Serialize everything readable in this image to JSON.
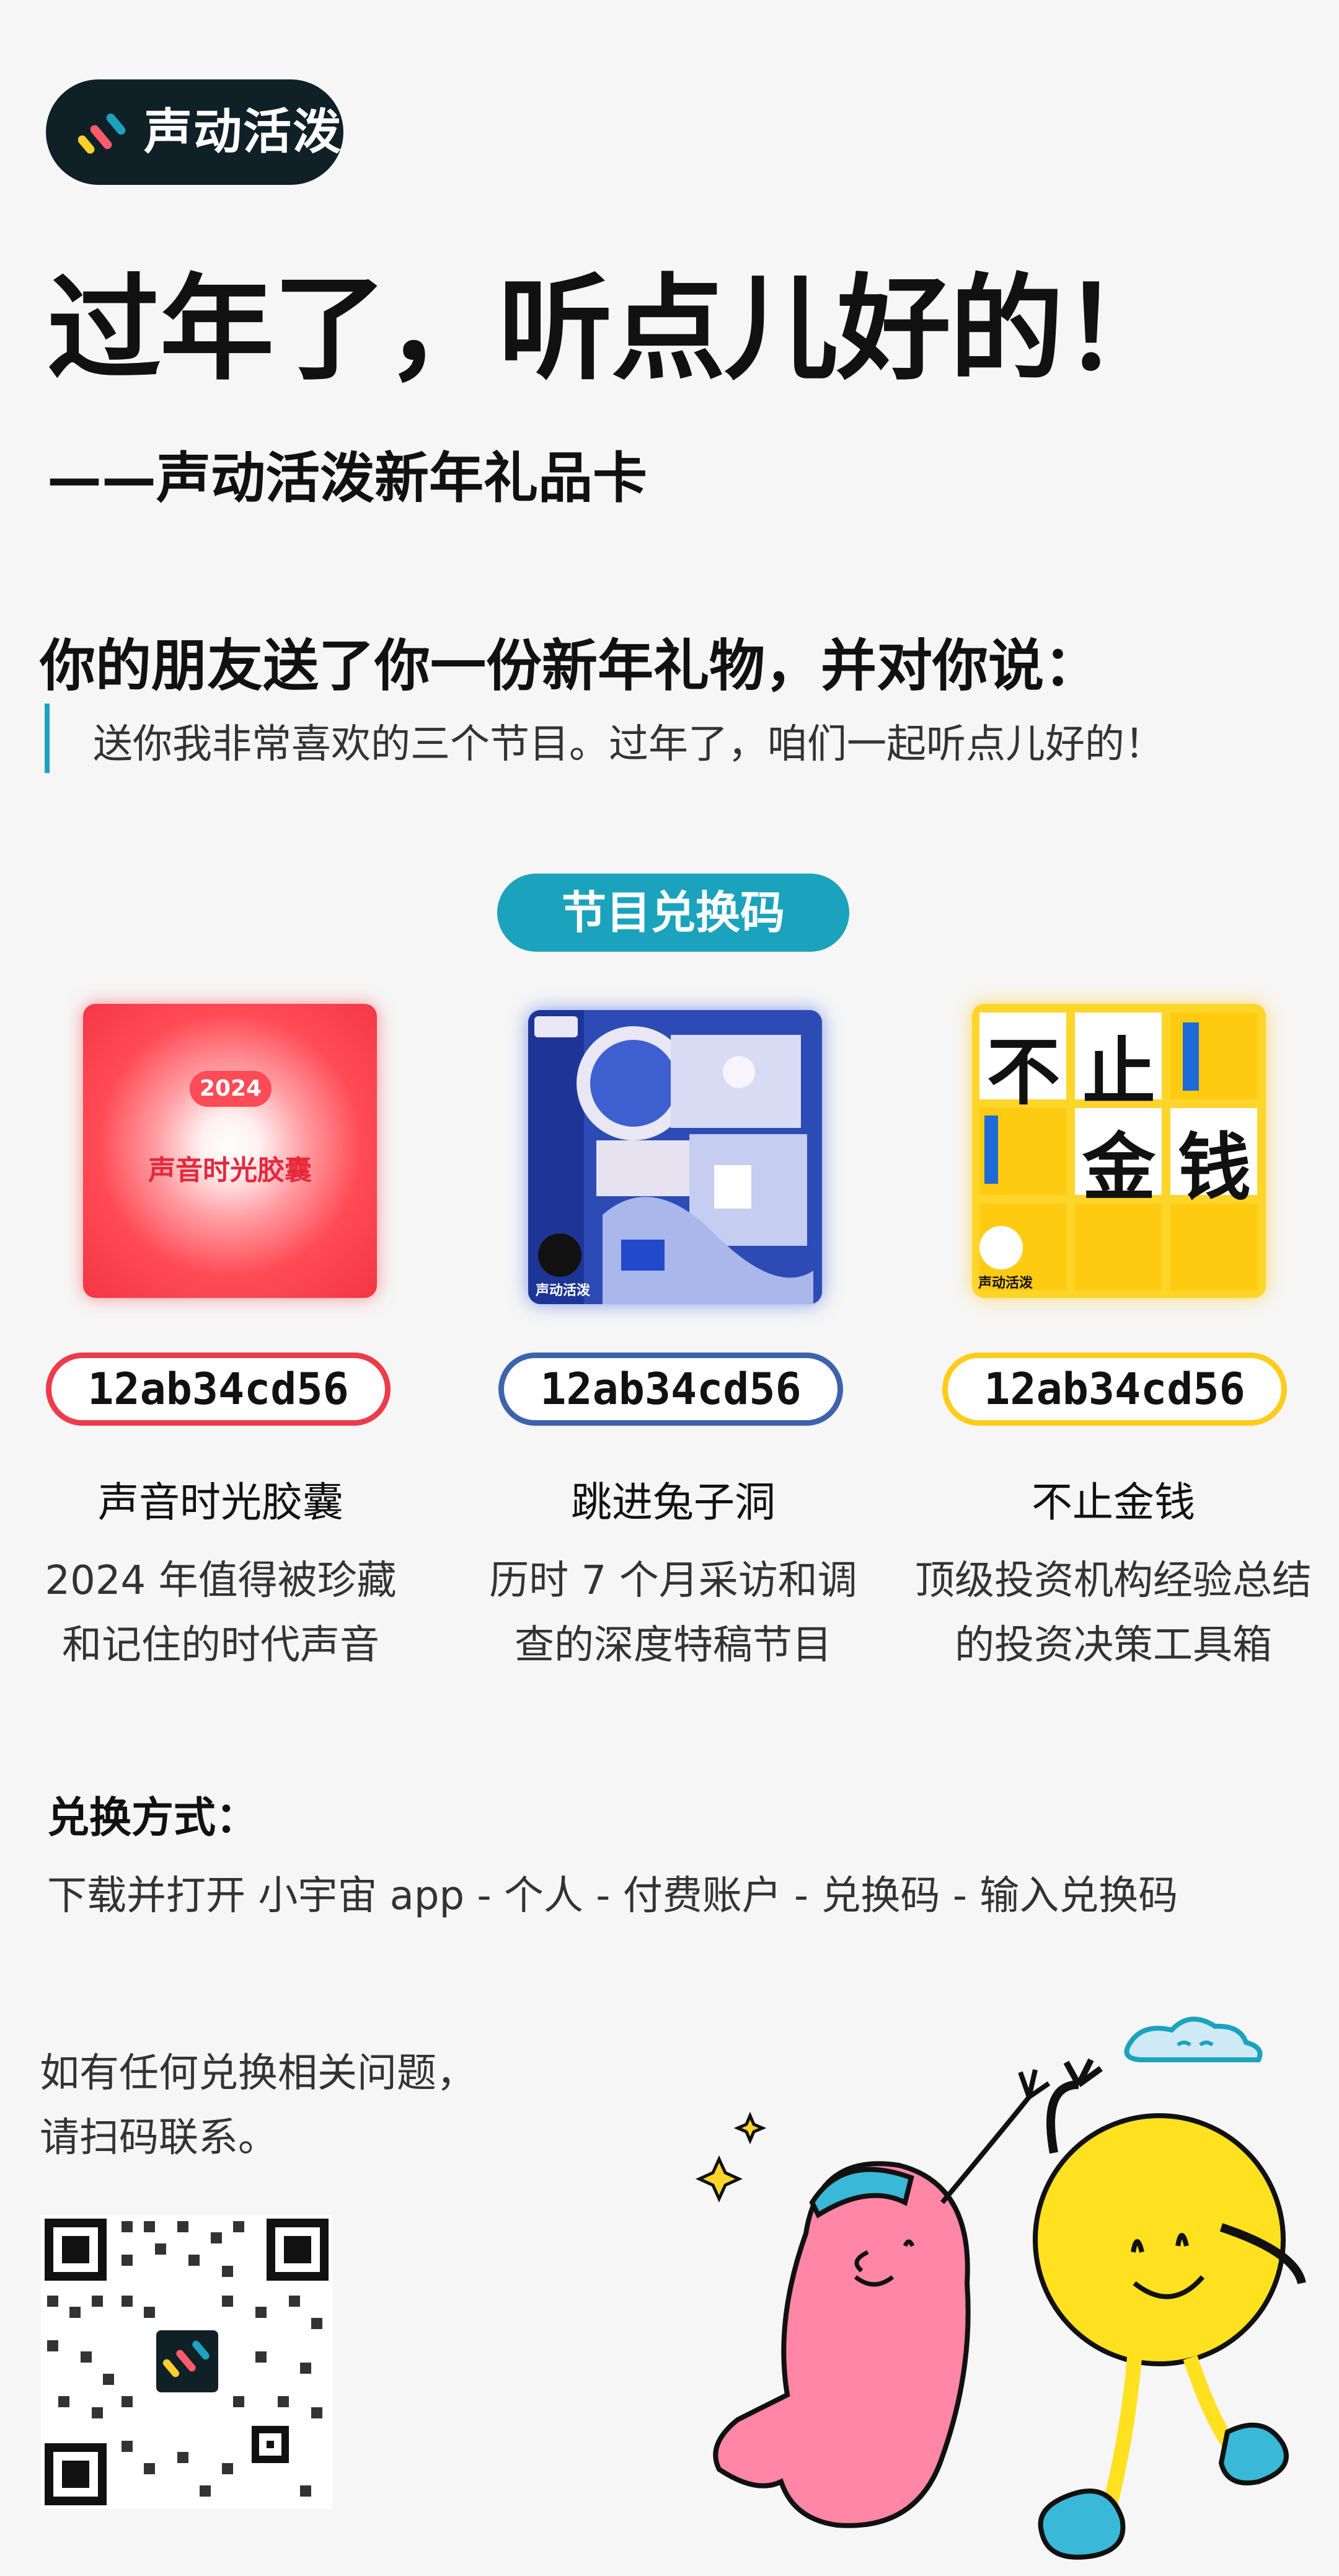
{
  "brand": {
    "name": "声动活泼"
  },
  "headline": "过年了，听点儿好的！",
  "subheadline": "——声动活泼新年礼品卡",
  "message": {
    "intro": "你的朋友送了你一份新年礼物，并对你说：",
    "quote": "送你我非常喜欢的三个节目。过年了，咱们一起听点儿好的！"
  },
  "section_label": "节目兑换码",
  "shows": [
    {
      "title": "声音时光胶囊",
      "code": "12ab34cd56",
      "description_line1": "2024 年值得被珍藏",
      "description_line2": "和记住的时代声音",
      "cover_badge": "2024",
      "cover_title": "声音时光胶囊",
      "accent_color": "#ec3b4a"
    },
    {
      "title": "跳进兔子洞",
      "code": "12ab34cd56",
      "description_line1": "历时 7 个月采访和调",
      "description_line2": "查的深度特稿节目",
      "cover_brand": "声动活泼",
      "accent_color": "#3c63ac"
    },
    {
      "title": "不止金钱",
      "code": "12ab34cd56",
      "description_line1": "顶级投资机构经验总结",
      "description_line2": "的投资决策工具箱",
      "cover_chars": [
        "不",
        "止",
        "金",
        "钱"
      ],
      "cover_brand": "声动活泼",
      "accent_color": "#ffcc1a"
    }
  ],
  "redeem": {
    "title": "兑换方式：",
    "steps": "下载并打开 小宇宙 app - 个人 - 付费账户 - 兑换码 - 输入兑换码"
  },
  "help": {
    "line1": "如有任何兑换相关问题，",
    "line2": "请扫码联系。"
  },
  "colors": {
    "primary": "#1ba3bd",
    "dark": "#0f2026",
    "background": "#f6f6f6"
  }
}
